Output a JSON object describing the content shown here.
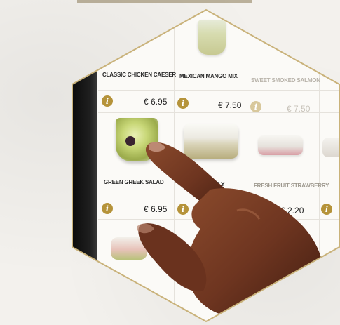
{
  "menu": {
    "items": [
      {
        "name": "CLASSIC CHICKEN CAESER",
        "price": "€ 6.95",
        "info": "i"
      },
      {
        "name": "MEXICAN MANGO MIX",
        "price": "€ 7.50",
        "info": "i"
      },
      {
        "name": "SWEET SMOKED SALMON",
        "price": "€ 7.50",
        "info": "i"
      },
      {
        "name": "GREEN GREEK SALAD",
        "price": "€ 6.95",
        "info": "i"
      },
      {
        "name": "GRANOLA AND Y",
        "price": "",
        "info": "i"
      },
      {
        "name": "FRESH FRUIT STRAWBERRY",
        "price": "€ 2.20",
        "info": "i"
      }
    ]
  },
  "icons": {
    "info": "info-icon"
  },
  "colors": {
    "accent": "#b5933a",
    "hex_border": "#c9b27a"
  }
}
